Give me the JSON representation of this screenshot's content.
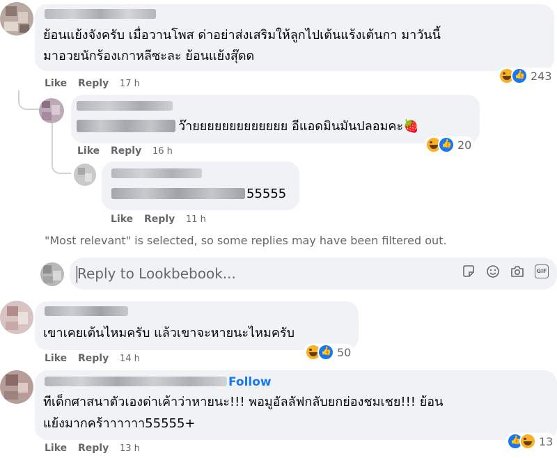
{
  "comments": [
    {
      "text_line1": "ย้อนแย้งจังครับ เมื่อวานโพส ด่าอย่าส่งเสริมให้ลูกไปเต้นแร้งเต้นกา มาวันนี้",
      "text_line2": "มาอวยนักร้องเกาหลีซะละ ย้อนแย้งสุ๊ดด",
      "like_label": "Like",
      "reply_label": "Reply",
      "time": "17 h",
      "reaction_count": "243",
      "reactions": [
        "haha-icon",
        "like-icon"
      ]
    },
    {
      "text_line1": "ว๊ายยยยยยยยยยยยย อีแอดมินมันปลอมคะ🍓",
      "like_label": "Like",
      "reply_label": "Reply",
      "time": "16 h",
      "reaction_count": "20",
      "reactions": [
        "haha-icon",
        "like-icon"
      ]
    },
    {
      "text_line1": "55555",
      "like_label": "Like",
      "reply_label": "Reply",
      "time": "11 h"
    },
    {
      "text_line1": "เขาเคยเต้นไหมครับ แล้วเขาจะหายนะไหมครับ",
      "like_label": "Like",
      "reply_label": "Reply",
      "time": "14 h",
      "reaction_count": "50",
      "reactions": [
        "haha-icon",
        "like-icon"
      ]
    },
    {
      "follow_label": "Follow",
      "text_line1": "ทีเด็กศาสนาตัวเองด่าเค้าว่าหายนะ!!! พอมูอัลลัฟกลับยกย่องชมเชย!!! ย้อน",
      "text_line2": "แย้งมากคร้าาาาาา55555+",
      "like_label": "Like",
      "reply_label": "Reply",
      "time": "13 h",
      "reaction_count": "13",
      "reactions": [
        "like-icon",
        "haha-icon"
      ]
    }
  ],
  "filter_notice": "\"Most relevant\" is selected, so some replies may have been filtered out.",
  "reply_box": {
    "placeholder": "Reply to Lookbebook...",
    "tools": [
      "sticker-icon",
      "emoji-icon",
      "camera-icon",
      "gif-icon"
    ],
    "gif_label": "GIF"
  },
  "colors": {
    "accent": "#1877f2",
    "bubble": "#f0f2f5",
    "secondary_text": "#65676b"
  }
}
